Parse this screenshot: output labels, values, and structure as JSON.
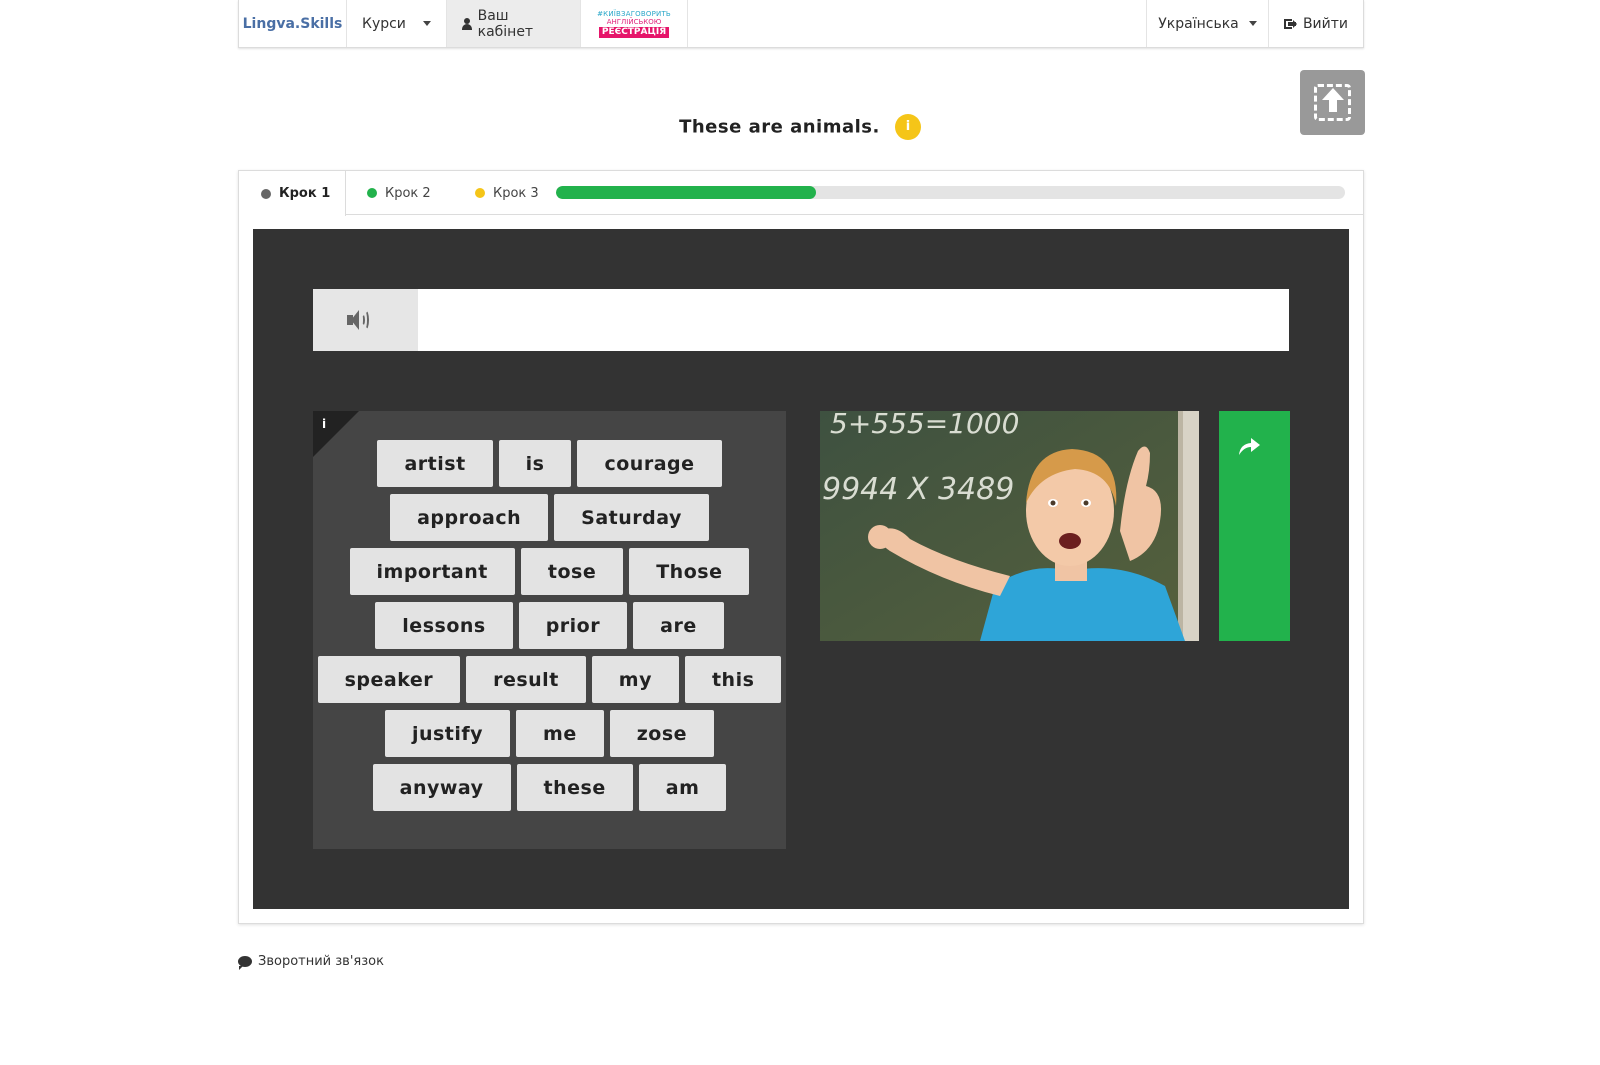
{
  "navbar": {
    "brand": "Lingva.Skills",
    "courses": "Курси",
    "cabinet": "Ваш кабінет",
    "promo": {
      "line1": "#КИЇВЗАГОВОРИТЬ",
      "line2": "АНГЛІЙСЬКОЮ",
      "badge": "РЕЄСТРАЦІЯ"
    },
    "language": "Українська",
    "logout": "Вийти"
  },
  "lesson": {
    "title": "These are animals.",
    "info_symbol": "i"
  },
  "tabs": [
    {
      "label": "Крок 1",
      "dot_color": "#666666",
      "active": true
    },
    {
      "label": "Крок 2",
      "dot_color": "#22b24c",
      "active": false
    },
    {
      "label": "Крок 3",
      "dot_color": "#f5c518",
      "active": false
    }
  ],
  "progress": {
    "percent": 33
  },
  "exercise": {
    "corner_info": "i",
    "word_rows": [
      [
        "artist",
        "is",
        "courage"
      ],
      [
        "approach",
        "Saturday"
      ],
      [
        "important",
        "tose",
        "Those"
      ],
      [
        "lessons",
        "prior",
        "are"
      ],
      [
        "speaker",
        "result",
        "my",
        "this"
      ],
      [
        "justify",
        "me",
        "zose"
      ],
      [
        "anyway",
        "these",
        "am"
      ]
    ],
    "image": {
      "chalkboard_line1": "5+555=1000",
      "chalkboard_line2": "9944 X 3489"
    }
  },
  "footer": {
    "feedback": "Зворотний зв'язок"
  },
  "colors": {
    "accent_green": "#22b24c",
    "info_yellow": "#f5c518",
    "stage_bg": "#333333"
  },
  "icons": [
    "user-icon",
    "caret-down-icon",
    "logout-icon",
    "upload-icon",
    "info-icon",
    "speaker-icon",
    "share-arrow-icon",
    "comment-icon"
  ]
}
